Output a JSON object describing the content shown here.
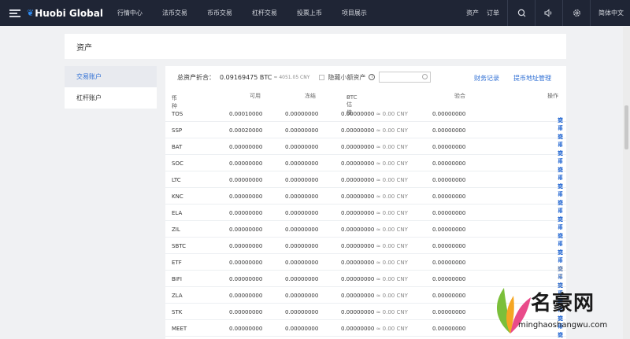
{
  "nav": {
    "logo": "Huobi Global",
    "items": [
      "行情中心",
      "法币交易",
      "币币交易",
      "杠杆交易",
      "投票上币",
      "项目展示"
    ],
    "assets": "资产",
    "orders": "订单",
    "lang": "简体中文",
    "icons": [
      "user-icon",
      "speaker-icon",
      "settings-icon"
    ]
  },
  "page_title": "资产",
  "side": {
    "items": [
      "交易账户",
      "杠杆账户"
    ]
  },
  "summary": {
    "label": "总资产折合：",
    "btc": "0.09169475 BTC",
    "cny": "≈ 4051.05 CNY",
    "hide_small": "隐藏小额资产",
    "info": "i",
    "finance_record": "财务记录",
    "withdraw_addr": "提币地址管理"
  },
  "table": {
    "headers": {
      "coin": "币种",
      "available": "可用",
      "frozen": "冻结",
      "btc_value": "BTC估值",
      "ratio": "验合",
      "ops": "操作"
    },
    "sort_glyph": "▴▾",
    "op_labels": [
      "充币",
      "提币",
      "交易"
    ],
    "rows": [
      {
        "coin": "TOS",
        "available": "0.00010000",
        "frozen": "0.00000000",
        "btc": "0.00000000",
        "cny": "≈ 0.00 CNY",
        "ratio": "0.00000000"
      },
      {
        "coin": "SSP",
        "available": "0.00020000",
        "frozen": "0.00000000",
        "btc": "0.00000000",
        "cny": "≈ 0.00 CNY",
        "ratio": "0.00000000"
      },
      {
        "coin": "BAT",
        "available": "0.00000000",
        "frozen": "0.00000000",
        "btc": "0.00000000",
        "cny": "≈ 0.00 CNY",
        "ratio": "0.00000000"
      },
      {
        "coin": "SOC",
        "available": "0.00000000",
        "frozen": "0.00000000",
        "btc": "0.00000000",
        "cny": "≈ 0.00 CNY",
        "ratio": "0.00000000"
      },
      {
        "coin": "LTC",
        "available": "0.00000000",
        "frozen": "0.00000000",
        "btc": "0.00000000",
        "cny": "≈ 0.00 CNY",
        "ratio": "0.00000000"
      },
      {
        "coin": "KNC",
        "available": "0.00000000",
        "frozen": "0.00000000",
        "btc": "0.00000000",
        "cny": "≈ 0.00 CNY",
        "ratio": "0.00000000"
      },
      {
        "coin": "ELA",
        "available": "0.00000000",
        "frozen": "0.00000000",
        "btc": "0.00000000",
        "cny": "≈ 0.00 CNY",
        "ratio": "0.00000000"
      },
      {
        "coin": "ZIL",
        "available": "0.00000000",
        "frozen": "0.00000000",
        "btc": "0.00000000",
        "cny": "≈ 0.00 CNY",
        "ratio": "0.00000000"
      },
      {
        "coin": "SBTC",
        "available": "0.00000000",
        "frozen": "0.00000000",
        "btc": "0.00000000",
        "cny": "≈ 0.00 CNY",
        "ratio": "0.00000000"
      },
      {
        "coin": "ETF",
        "available": "0.00000000",
        "frozen": "0.00000000",
        "btc": "0.00000000",
        "cny": "≈ 0.00 CNY",
        "ratio": "0.00000000"
      },
      {
        "coin": "BIFI",
        "available": "0.00000000",
        "frozen": "0.00000000",
        "btc": "0.00000000",
        "cny": "≈ 0.00 CNY",
        "ratio": "0.00000000"
      },
      {
        "coin": "ZLA",
        "available": "0.00000000",
        "frozen": "0.00000000",
        "btc": "0.00000000",
        "cny": "≈ 0.00 CNY",
        "ratio": "0.00000000"
      },
      {
        "coin": "STK",
        "available": "0.00000000",
        "frozen": "0.00000000",
        "btc": "0.00000000",
        "cny": "≈ 0.00 CNY",
        "ratio": "0.00000000"
      },
      {
        "coin": "MEET",
        "available": "0.00000000",
        "frozen": "0.00000000",
        "btc": "0.00000000",
        "cny": "≈ 0.00 CNY",
        "ratio": "0.00000000"
      }
    ]
  },
  "watermark": {
    "title": "名豪网",
    "url": "minghaoshangwu.com"
  },
  "colors": {
    "nav_bg": "#1f2535",
    "accent": "#2f6fd4",
    "page_bg": "#f0f1f3"
  }
}
